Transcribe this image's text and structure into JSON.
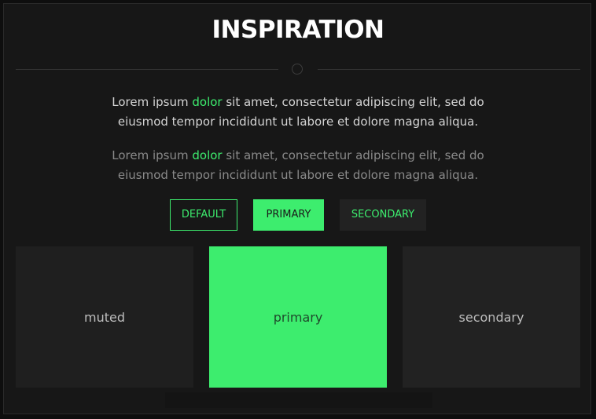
{
  "header": {
    "title": "INSPIRATION"
  },
  "paragraphs": [
    {
      "before": "Lorem ipsum ",
      "highlight": "dolor",
      "after": " sit amet, consectetur adipiscing elit, sed do eiusmod tempor incididunt ut labore et dolore magna aliqua."
    },
    {
      "before": "Lorem ipsum ",
      "highlight": "dolor",
      "after": " sit amet, consectetur adipiscing elit, sed do eiusmod tempor incididunt ut labore et dolore magna aliqua."
    }
  ],
  "buttons": {
    "default_label": "DEFAULT",
    "primary_label": "PRIMARY",
    "secondary_label": "SECONDARY"
  },
  "tiles": {
    "muted_label": "muted",
    "primary_label": "primary",
    "secondary_label": "secondary"
  },
  "colors": {
    "accent": "#3ded6e",
    "background": "#171717",
    "surface": "#1f1f1f",
    "text": "#d4d4d4",
    "muted_text": "#8a8a8a"
  }
}
